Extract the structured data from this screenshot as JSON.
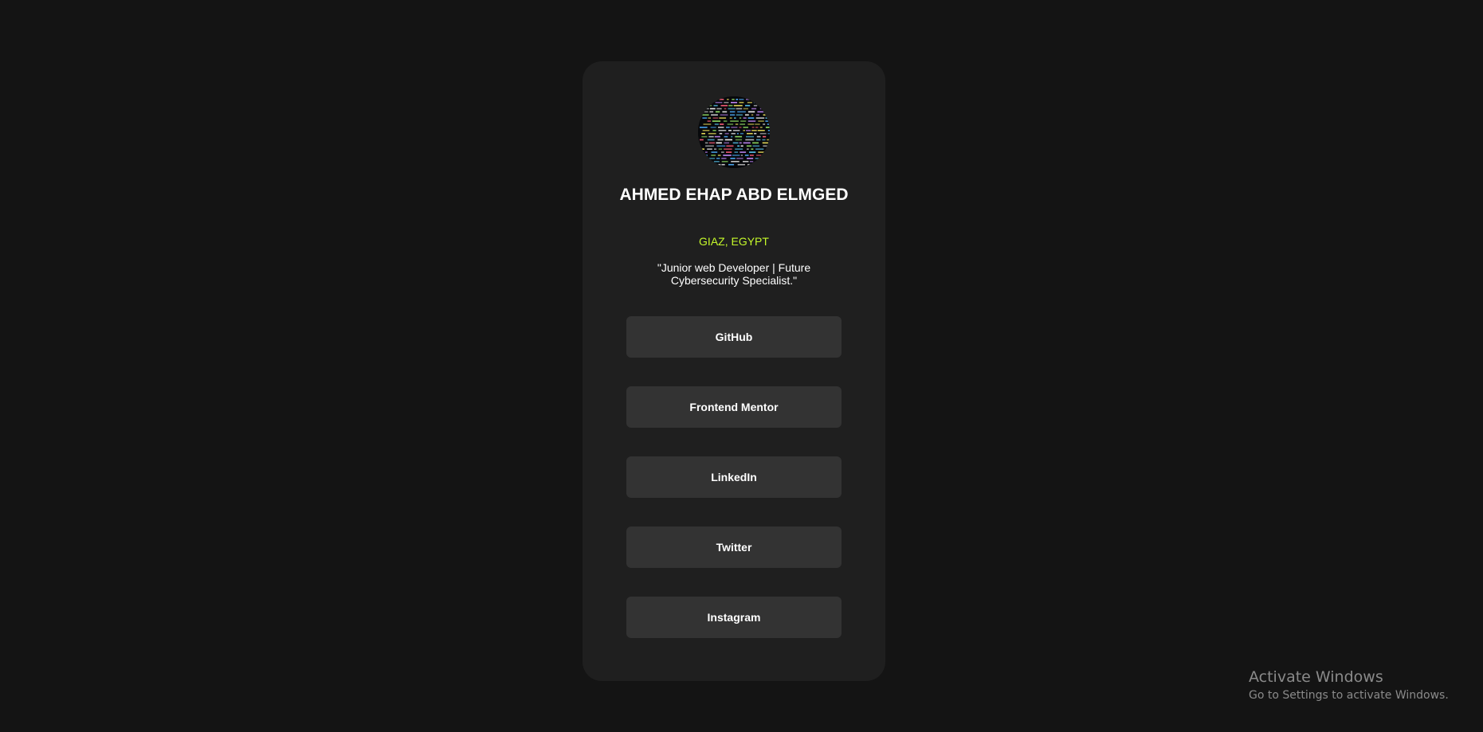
{
  "profile": {
    "name": "AHMED EHAP ABD ELMGED",
    "location": "GIAZ, EGYPT",
    "bio": "\"Junior web Developer | Future Cybersecurity Specialist.\"",
    "avatar_icon": "code-screen-avatar"
  },
  "links": [
    {
      "label": "GitHub"
    },
    {
      "label": "Frontend Mentor"
    },
    {
      "label": "LinkedIn"
    },
    {
      "label": "Twitter"
    },
    {
      "label": "Instagram"
    }
  ],
  "watermark": {
    "title": "Activate Windows",
    "subtitle": "Go to Settings to activate Windows."
  },
  "colors": {
    "background": "#141414",
    "card": "#1f1f1f",
    "button": "#333333",
    "accent": "#c4f82a",
    "text": "#ffffff"
  }
}
